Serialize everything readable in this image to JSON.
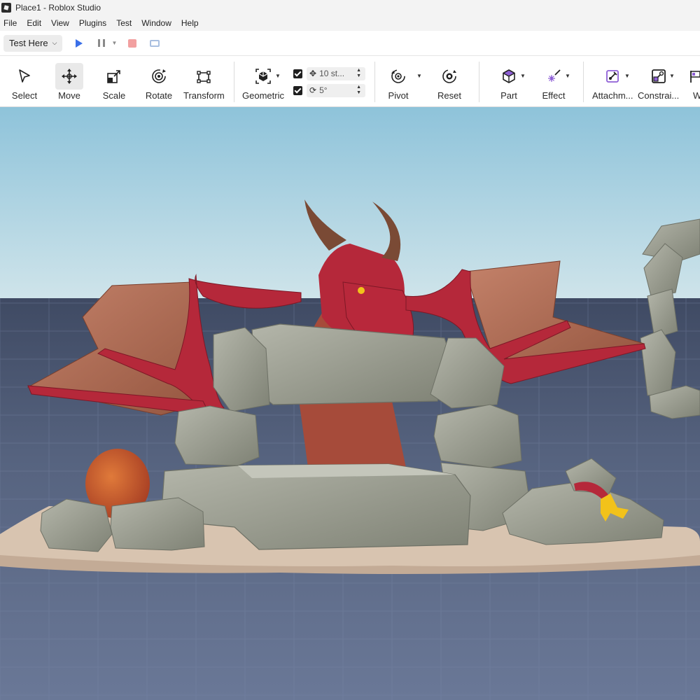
{
  "window": {
    "title": "Place1 - Roblox Studio"
  },
  "menu": [
    "File",
    "Edit",
    "View",
    "Plugins",
    "Test",
    "Window",
    "Help"
  ],
  "testbar": {
    "mode_label": "Test Here"
  },
  "ribbon": {
    "select": "Select",
    "move": "Move",
    "scale": "Scale",
    "rotate": "Rotate",
    "transform": "Transform",
    "geometric": "Geometric",
    "move_snap_value": "10 st...",
    "rotate_snap_value": "5°",
    "pivot": "Pivot",
    "reset": "Reset",
    "part": "Part",
    "effect": "Effect",
    "attachment": "Attachm...",
    "constraint": "Constrai...",
    "next_cut": "W"
  },
  "colors": {
    "accent": "#3a6fe8",
    "stop": "#f2a0a0",
    "sky_top": "#8ec3da",
    "sky_bottom": "#cfe4ea",
    "baseplate": "#5b6a8a",
    "dragon": "#b5283a",
    "wing": "#b06a4e",
    "stone": "#9a9c8e",
    "sand": "#d8c4b0"
  }
}
